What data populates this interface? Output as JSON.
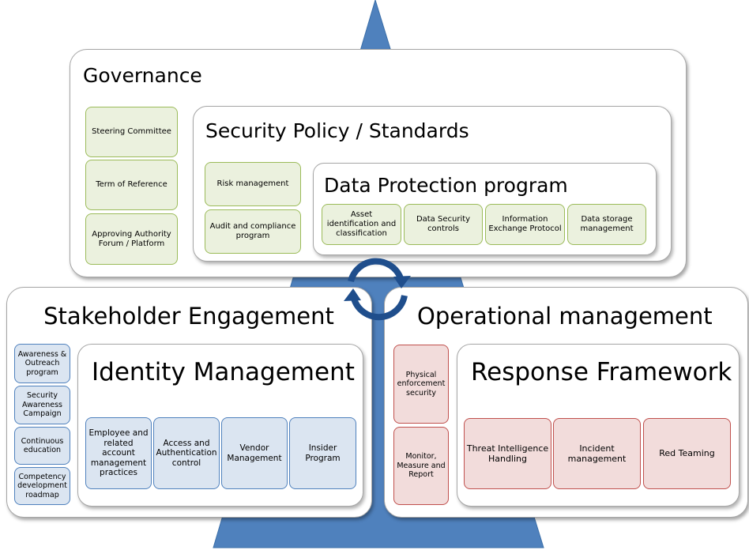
{
  "colors": {
    "triangle": "#4f81bd",
    "cycle": "#1f4e8c",
    "green_fill": "#ebf1de",
    "green_border": "#9bbb59",
    "blue_fill": "#dbe5f1",
    "blue_border": "#4f81bd",
    "red_fill": "#f2dcdb",
    "red_border": "#c0504d"
  },
  "icons": {
    "center": "cycle-arrows-icon"
  },
  "governance": {
    "title": "Governance",
    "items": [
      "Steering Committee",
      "Term of Reference",
      "Approving Authority Forum / Platform"
    ]
  },
  "security_policy": {
    "title": "Security Policy / Standards",
    "items": [
      "Risk management",
      "Audit and compliance program"
    ]
  },
  "data_protection": {
    "title": "Data Protection program",
    "items": [
      "Asset identification and classification",
      "Data Security controls",
      "Information Exchange Protocol",
      "Data storage management"
    ]
  },
  "stakeholder": {
    "title": "Stakeholder Engagement",
    "items": [
      "Awareness & Outreach program",
      "Security Awareness Campaign",
      "Continuous education",
      "Competency development roadmap"
    ]
  },
  "identity": {
    "title": "Identity Management",
    "items": [
      "Employee and related account management practices",
      "Access and Authentication control",
      "Vendor Management",
      "Insider Program"
    ]
  },
  "operational": {
    "title": "Operational management",
    "items": [
      "Physical enforcement security",
      "Monitor, Measure and Report"
    ]
  },
  "response": {
    "title": "Response Framework",
    "items": [
      "Threat Intelligence Handling",
      "Incident management",
      "Red Teaming"
    ]
  }
}
